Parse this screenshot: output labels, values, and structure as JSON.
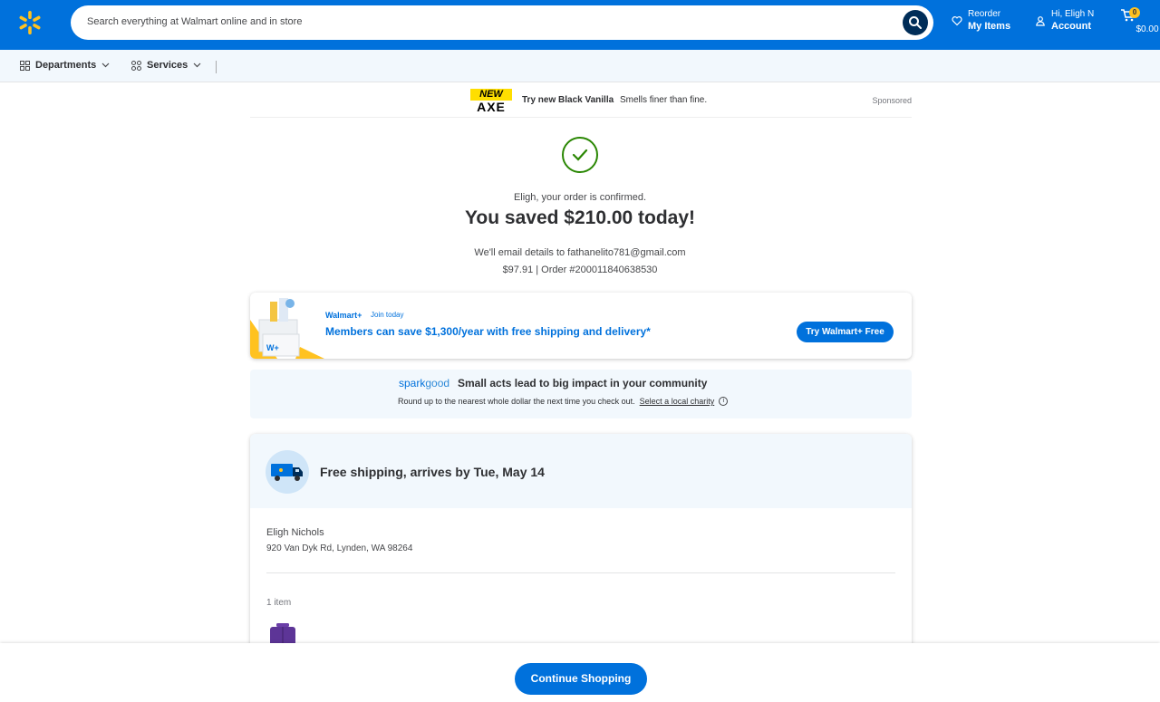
{
  "header": {
    "search_placeholder": "Search everything at Walmart online and in store",
    "reorder_top": "Reorder",
    "reorder_bottom": "My Items",
    "account_top": "Hi, Eligh N",
    "account_bottom": "Account",
    "cart_count": "0",
    "cart_total": "$0.00",
    "brand_color": "#0071dc",
    "spark_color": "#ffc220"
  },
  "subnav": {
    "departments": "Departments",
    "services": "Services"
  },
  "ad": {
    "logo_new": "NEW",
    "logo_name": "AXE",
    "headline": "Try new Black Vanilla",
    "tagline": "Smells finer than fine.",
    "sponsored": "Sponsored"
  },
  "confirmation": {
    "line1": "Eligh, your order is confirmed.",
    "headline": "You saved $210.00 today!",
    "email_line": "We'll email details to fathanelito781@gmail.com",
    "order_line": "$97.91 | Order #200011840638530"
  },
  "walmart_plus": {
    "brand": "Walmart+",
    "join": "Join today",
    "message": "Members can save $1,300/year with free shipping and delivery*",
    "button": "Try Walmart+ Free"
  },
  "sparkgood": {
    "logo_a": "spark",
    "logo_b": "good",
    "title": "Small acts lead to big impact in your community",
    "subtitle": "Round up to the nearest whole dollar the next time you check out.",
    "link": "Select a local charity"
  },
  "shipping": {
    "title": "Free shipping, arrives by Tue, May 14",
    "name": "Eligh Nichols",
    "address": "920 Van Dyk Rd, Lynden, WA 98264",
    "item_count": "1 item"
  },
  "footer": {
    "continue": "Continue Shopping"
  }
}
